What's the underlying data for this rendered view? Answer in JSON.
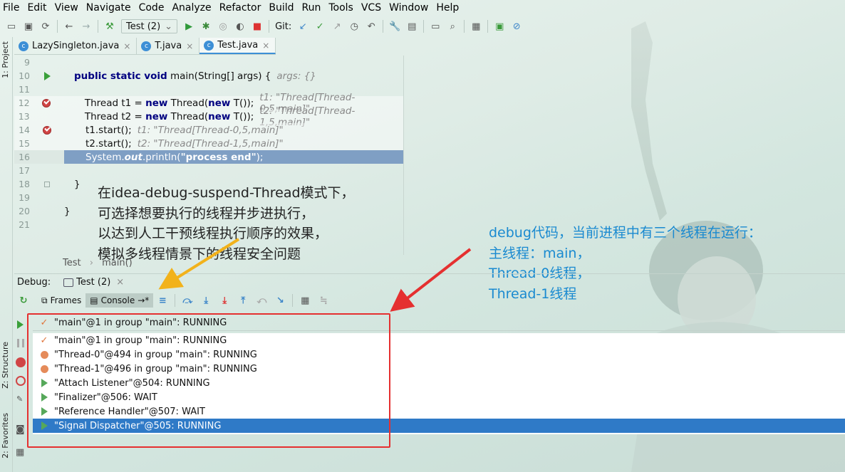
{
  "menu": [
    "File",
    "Edit",
    "View",
    "Navigate",
    "Code",
    "Analyze",
    "Refactor",
    "Build",
    "Run",
    "Tools",
    "VCS",
    "Window",
    "Help"
  ],
  "toolbar": {
    "run_config": "Test (2)",
    "git_label": "Git:"
  },
  "side_tabs": {
    "project": "1: Project",
    "structure": "Z: Structure",
    "favorites": "2: Favorites"
  },
  "tabs": [
    {
      "label": "LazySingleton.java",
      "icon": "class-icon"
    },
    {
      "label": "T.java",
      "icon": "class-icon"
    },
    {
      "label": "Test.java",
      "icon": "class-icon",
      "active": true
    }
  ],
  "code": {
    "ln9": "9",
    "ln10": "10",
    "ln11": "11",
    "ln12": "12",
    "ln13": "13",
    "ln14": "14",
    "ln15": "15",
    "ln16": "16",
    "ln17": "17",
    "ln18": "18",
    "ln19": "19",
    "ln20": "20",
    "ln21": "21",
    "l10_kw": "public static void",
    "l10_rest": " main(String[] args) {",
    "l10_hint": "args: {}",
    "l12_a": "Thread t1 = ",
    "l12_new1": "new",
    "l12_b": " Thread(",
    "l12_new2": "new",
    "l12_c": " T());",
    "l12_hint": "t1: \"Thread[Thread-0,5,main]\"",
    "l13_a": "Thread t2 = ",
    "l13_new1": "new",
    "l13_b": " Thread(",
    "l13_new2": "new",
    "l13_c": " T());",
    "l13_hint": "t2: \"Thread[Thread-1,5,main]\"",
    "l14": "t1.start();",
    "l14_hint": "t1: \"Thread[Thread-0,5,main]\"",
    "l15": "t2.start();",
    "l15_hint": "t2: \"Thread[Thread-1,5,main]\"",
    "l16_a": "System.",
    "l16_out": "out",
    "l16_b": ".println(",
    "l16_str": "\"process end\"",
    "l16_c": ");",
    "l18": "}",
    "l20": "}"
  },
  "breadcrumb": {
    "class": "Test",
    "method": "main()",
    "sep": "›"
  },
  "annotation_black": "在idea-debug-suspend-Thread模式下，\n可选择想要执行的线程并步进执行，\n以达到人工干预线程执行顺序的效果，\n模拟多线程情景下的线程安全问题",
  "annotation_blue": "debug代码，当前进程中有三个线程在运行：\n主线程：main，\nThread-0线程，\nThread-1线程",
  "debug": {
    "label": "Debug:",
    "session": "Test (2)",
    "frames_label": "Frames",
    "console_label": "Console",
    "combo_value": "\"main\"@1 in group \"main\": RUNNING",
    "threads": [
      {
        "text": "\"main\"@1 in group \"main\": RUNNING",
        "state": "check"
      },
      {
        "text": "\"Thread-0\"@494 in group \"main\": RUNNING",
        "state": "dot"
      },
      {
        "text": "\"Thread-1\"@496 in group \"main\": RUNNING",
        "state": "dot"
      },
      {
        "text": "\"Attach Listener\"@504: RUNNING",
        "state": "play"
      },
      {
        "text": "\"Finalizer\"@506: WAIT",
        "state": "play"
      },
      {
        "text": "\"Reference Handler\"@507: WAIT",
        "state": "play"
      },
      {
        "text": "\"Signal Dispatcher\"@505: RUNNING",
        "state": "play",
        "selected": true
      }
    ]
  },
  "colors": {
    "accent": "#2f7ac7",
    "annotation_blue": "#1a8ad0",
    "highlight_box": "#e53030",
    "arrow_yellow": "#f2b21b"
  }
}
